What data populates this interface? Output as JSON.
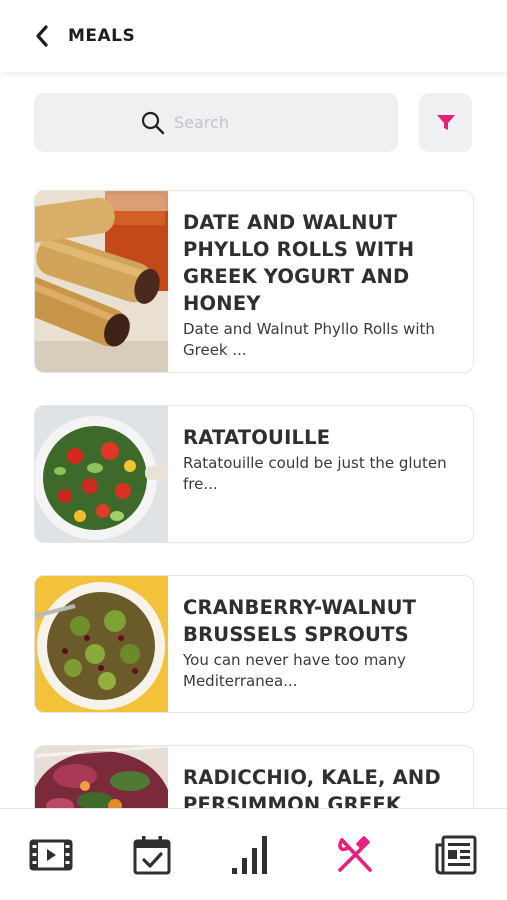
{
  "header": {
    "title": "MEALS"
  },
  "search": {
    "placeholder": "Search",
    "value": ""
  },
  "colors": {
    "accent": "#e8207d",
    "icon": "#2f3033"
  },
  "meals": [
    {
      "title": "Date and Walnut Phyllo Rolls with Greek Yogurt and Honey",
      "description": "Date and Walnut Phyllo Rolls with Greek ..."
    },
    {
      "title": "Ratatouille",
      "description": "Ratatouille could be just the gluten fre..."
    },
    {
      "title": "Cranberry-Walnut Brussels Sprouts",
      "description": "You can never have too many Mediterranea..."
    },
    {
      "title": "Radicchio, Kale, and Persimmon Greek",
      "description": ""
    }
  ],
  "nav": [
    {
      "icon": "videos-icon",
      "active": false
    },
    {
      "icon": "calendar-icon",
      "active": false
    },
    {
      "icon": "stats-icon",
      "active": false
    },
    {
      "icon": "meals-icon",
      "active": true
    },
    {
      "icon": "news-icon",
      "active": false
    }
  ]
}
